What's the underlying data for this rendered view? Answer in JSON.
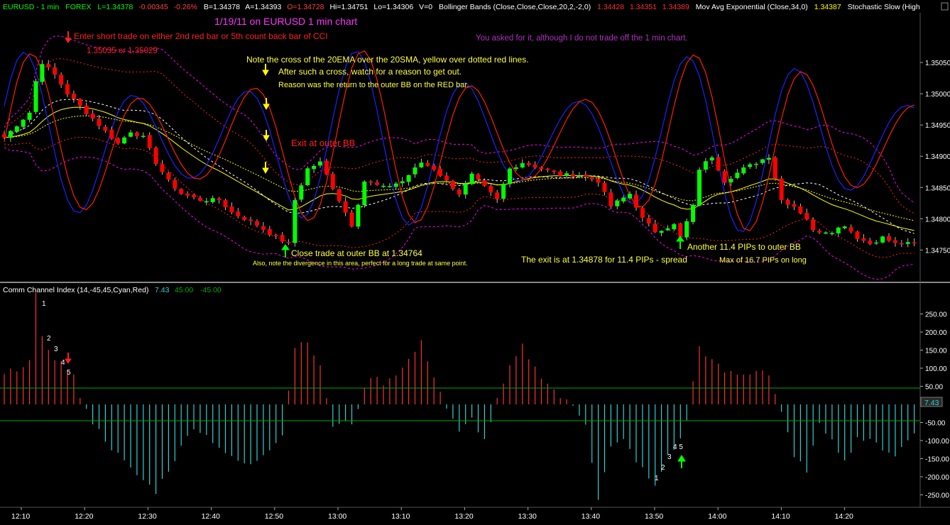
{
  "header": {
    "symbol": "EURUSD - 1 min",
    "market": "FOREX",
    "last": "L=1.34378",
    "change": "-0.00345",
    "change_pct": "-0.26%",
    "bid": "B=1.34378",
    "ask": "A=1.34393",
    "open": "O=1.34728",
    "high": "Hi=1.34751",
    "low": "Lo=1.34306",
    "volume": "V=0",
    "bb_label": "Bollinger Bands (Close,Close,Close,20,2,-2,0)",
    "bb_upper": "1.34428",
    "bb_mid": "1.34351",
    "bb_lower": "1.34389",
    "ema_label": "Mov Avg Exponential (Close,34,0)",
    "ema_value": "1.34387",
    "stoch_label": "Stochastic Slow (High"
  },
  "colors": {
    "up": "#00ff00",
    "down": "#ff0000",
    "bb": "#ff00ff",
    "bb_red": "#ff2020",
    "ema": "#ffff00",
    "stoch_k": "#2020ff",
    "stoch_d": "#ff2000",
    "cci_pos": "#ff3030",
    "cci_neg": "#30d0d0",
    "level": "#00aa00"
  },
  "annotations": {
    "title": "1/19/11 on EURUSD 1 min chart",
    "disclaimer": "You asked for it, although I do not trade off the 1 min chart.",
    "enter_short": "Enter short trade on either 2nd red bar or 5th count back bar of CCI",
    "enter_prices": "1.35035 or 1.35029",
    "note_cross": "Note the cross of the 20EMA over the 20SMA, yellow over dotted red lines.",
    "after_cross": "After such a cross, watch for a reason to get out.",
    "reason": "Reason was the return to the outer BB on the RED bar.",
    "exit_outer": "Exit at outer BB",
    "close_trade": "Close trade at outer BB at 1.34764",
    "divergence": "Also, note the divergence in this area, perfect for a long trade at same point.",
    "exit_price": "The exit is at 1.34878 for 11.4 PIPs - spread",
    "another": "Another 11.4 PIPs to outer BB",
    "max_pips": "Max of 16.7 PIPs on long",
    "count_left": [
      "1",
      "2",
      "3",
      "4",
      "5"
    ],
    "count_right": [
      "1",
      "2",
      "3",
      "4 5"
    ]
  },
  "cci_header": {
    "label": "Comm Channel Index (14,-45,45,Cyan,Red)",
    "value": "7.43",
    "upper": "45.00",
    "lower": "-45.00",
    "value_box": "7.43"
  },
  "chart_data": [
    {
      "type": "candlestick",
      "title": "",
      "y_ticks": [
        "1.35050",
        "1.35000",
        "1.34950",
        "1.34900",
        "1.34850",
        "1.34800",
        "1.34750"
      ],
      "ylim": [
        1.34705,
        1.35125
      ],
      "x_ticks": [
        "12:10",
        "12:20",
        "12:30",
        "12:40",
        "12:50",
        "13:00",
        "13:10",
        "13:20",
        "13:30",
        "13:40",
        "13:50",
        "14:00",
        "14:10",
        "14:20"
      ],
      "bars": 145,
      "key_prices": {
        "short_entries": [
          1.35035,
          1.35029
        ],
        "close": 1.34764,
        "exit": 1.34878
      },
      "pips": [
        11.4,
        11.4,
        16.7
      ]
    },
    {
      "type": "bar",
      "title": "Comm Channel Index (14,-45,45,Cyan,Red)",
      "y_ticks": [
        "250.00",
        "200.00",
        "150.00",
        "100.00",
        "50.00",
        "-50.00",
        "-100.00",
        "-150.00",
        "-200.00",
        "-250.00"
      ],
      "ylim": [
        -300,
        300
      ],
      "levels": [
        45,
        -45
      ],
      "last": 7.43
    }
  ]
}
